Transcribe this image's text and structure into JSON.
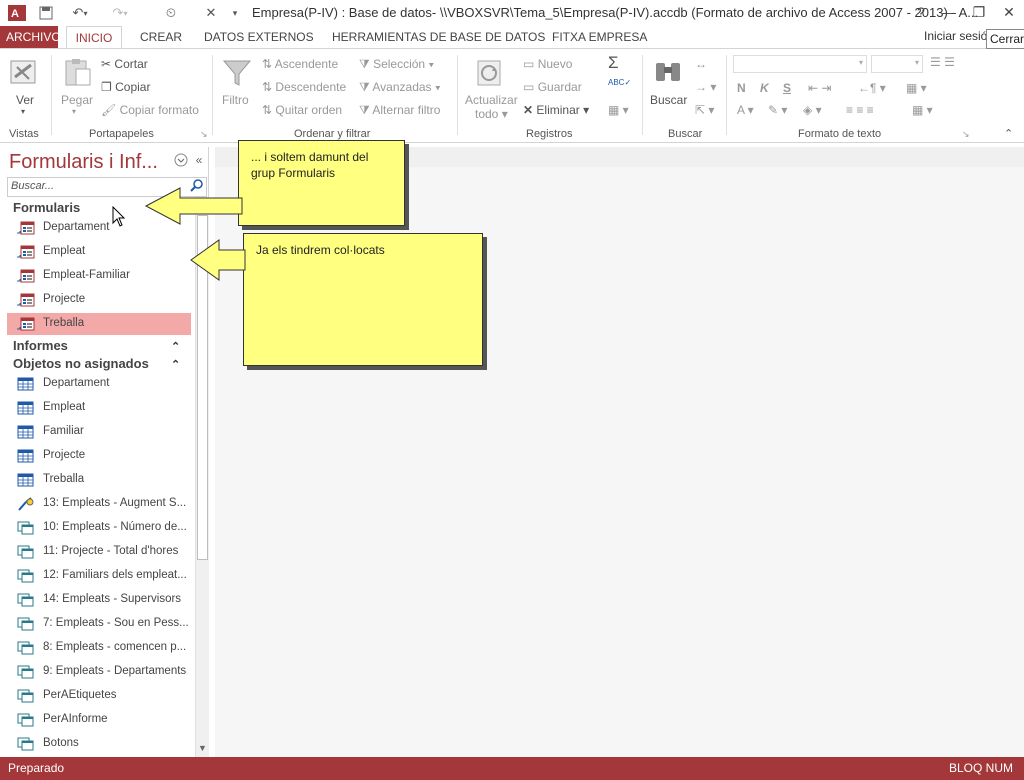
{
  "window": {
    "title": "Empresa(P-IV) : Base de datos- \\\\VBOXSVR\\Tema_5\\Empresa(P-IV).accdb (Formato de archivo de Access 2007 - 2013) - A...",
    "help": "?",
    "close_tooltip": "Cerrar"
  },
  "tabs": {
    "archivo": "ARCHIVO",
    "inicio": "INICIO",
    "crear": "CREAR",
    "datos_externos": "DATOS EXTERNOS",
    "herramientas": "HERRAMIENTAS DE BASE DE DATOS",
    "fitxa": "FITXA EMPRESA",
    "signin": "Iniciar sesió"
  },
  "ribbon": {
    "vistas": {
      "ver": "Ver",
      "label": "Vistas"
    },
    "portapapeles": {
      "pegar": "Pegar",
      "cortar": "Cortar",
      "copiar": "Copiar",
      "copiar_formato": "Copiar formato",
      "label": "Portapapeles"
    },
    "ordenar": {
      "filtro": "Filtro",
      "ascendente": "Ascendente",
      "descendente": "Descendente",
      "quitar_orden": "Quitar orden",
      "seleccion": "Selección",
      "avanzadas": "Avanzadas",
      "alternar": "Alternar filtro",
      "label": "Ordenar y filtrar"
    },
    "registros": {
      "actualizar": "Actualizar",
      "todo": "todo",
      "nuevo": "Nuevo",
      "guardar": "Guardar",
      "eliminar": "Eliminar",
      "label": "Registros"
    },
    "buscar": {
      "buscar": "Buscar",
      "label": "Buscar"
    },
    "formato": {
      "negrita": "N",
      "cursiva": "K",
      "subrayado": "S",
      "label": "Formato de texto"
    }
  },
  "nav": {
    "title": "Formularis i Inf...",
    "search_placeholder": "Buscar...",
    "groups": {
      "formularis": "Formularis",
      "informes": "Informes",
      "objetos": "Objetos no asignados"
    },
    "forms": [
      "Departament",
      "Empleat",
      "Empleat-Familiar",
      "Projecte",
      "Treballa"
    ],
    "tables": [
      "Departament",
      "Empleat",
      "Familiar",
      "Projecte",
      "Treballa"
    ],
    "queries": [
      {
        "label": "13: Empleats - Augment S...",
        "icon": "update-query-icon"
      },
      {
        "label": "10: Empleats - Número de...",
        "icon": "query-icon"
      },
      {
        "label": "11: Projecte - Total d'hores",
        "icon": "query-icon"
      },
      {
        "label": "12: Familiars dels empleat...",
        "icon": "query-icon"
      },
      {
        "label": "14: Empleats - Supervisors",
        "icon": "query-icon"
      },
      {
        "label": "7: Empleats - Sou en Pess...",
        "icon": "query-icon"
      },
      {
        "label": "8: Empleats - comencen p...",
        "icon": "query-icon"
      },
      {
        "label": "9: Empleats - Departaments",
        "icon": "query-icon"
      },
      {
        "label": "PerAEtiquetes",
        "icon": "query-icon"
      },
      {
        "label": "PerAInforme",
        "icon": "query-icon"
      },
      {
        "label": "Botons",
        "icon": "query-icon"
      }
    ]
  },
  "callouts": {
    "first": "... i soltem damunt del grup Formularis",
    "second": "Ja els tindrem col·locats"
  },
  "status": {
    "left": "Preparado",
    "right": "BLOQ NUM"
  },
  "colors": {
    "accent": "#a4373a",
    "callout": "#ffff80",
    "selected": "#f4a9a9"
  }
}
